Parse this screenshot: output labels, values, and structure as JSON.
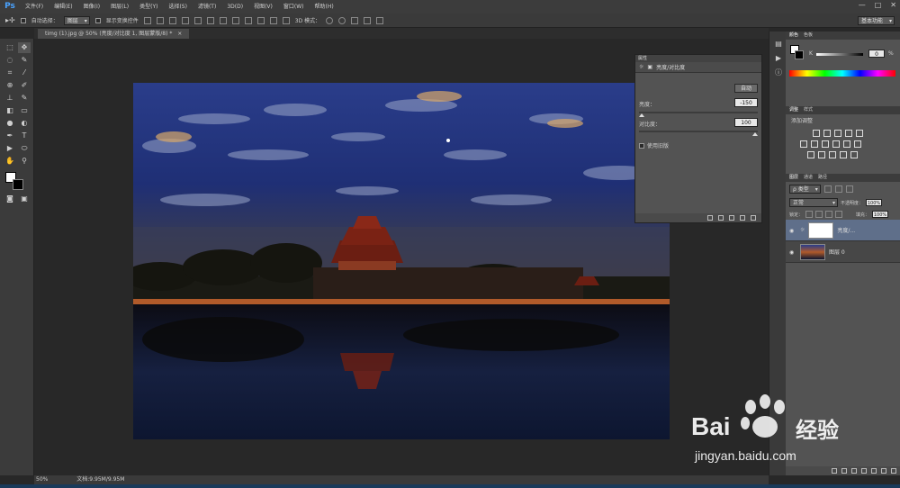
{
  "app": {
    "logo": "Ps"
  },
  "menus": [
    "文件(F)",
    "编辑(E)",
    "图像(I)",
    "图层(L)",
    "类型(Y)",
    "选择(S)",
    "滤镜(T)",
    "3D(D)",
    "视图(V)",
    "窗口(W)",
    "帮助(H)"
  ],
  "window_controls": [
    "—",
    "□",
    "✕"
  ],
  "options_bar": {
    "auto_select_label": "自动选择：",
    "auto_select_value": "图层",
    "show_transform_label": "显示变换控件",
    "mode_3d_label": "3D 模式：",
    "workspace": "基本功能"
  },
  "document_tab": {
    "title": "timg (1).jpg @ 50% (亮度/对比度 1, 图层蒙版/8) *",
    "close": "×"
  },
  "status": {
    "zoom": "50%",
    "doc_size": "文档:9.95M/9.95M"
  },
  "properties_panel": {
    "title": "属性",
    "type_label": "亮度/对比度",
    "auto_button": "自动",
    "brightness_label": "亮度：",
    "brightness_value": "-150",
    "brightness_fraction": 0.0,
    "contrast_label": "对比度：",
    "contrast_value": "100",
    "contrast_fraction": 1.0,
    "legacy_label": "使用旧版"
  },
  "color_panel": {
    "tabs": [
      "颜色",
      "色板"
    ],
    "channel_label": "K",
    "value": "0",
    "unit": "%"
  },
  "adjustments_panel": {
    "tabs": [
      "调整",
      "样式"
    ],
    "title": "添加调整"
  },
  "layers_panel": {
    "tabs": [
      "图层",
      "通道",
      "路径"
    ],
    "filter_label": "ρ 类型",
    "blend_mode": "正常",
    "opacity_label": "不透明度：",
    "opacity_value": "100%",
    "lock_label": "锁定：",
    "fill_label": "填充：",
    "fill_value": "100%",
    "layers": [
      {
        "name": "亮度/..."
      },
      {
        "name": "图层 0"
      }
    ]
  },
  "watermark": {
    "brand": "Bai",
    "cn": "经验",
    "url": "jingyan.baidu.com"
  },
  "colors": {
    "accent": "#4aa3ff",
    "arrow": "#e03a2f",
    "panel": "#535353"
  }
}
